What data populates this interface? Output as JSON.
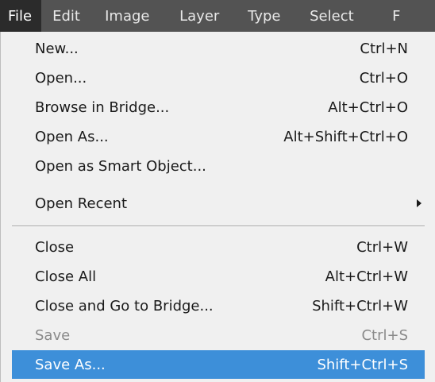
{
  "menubar": {
    "items": [
      {
        "label": "File",
        "active": true
      },
      {
        "label": "Edit"
      },
      {
        "label": "Image"
      },
      {
        "label": "Layer"
      },
      {
        "label": "Type"
      },
      {
        "label": "Select"
      },
      {
        "label": "F"
      }
    ]
  },
  "file_menu": {
    "items": [
      {
        "label": "New...",
        "shortcut": "Ctrl+N"
      },
      {
        "label": "Open...",
        "shortcut": "Ctrl+O"
      },
      {
        "label": "Browse in Bridge...",
        "shortcut": "Alt+Ctrl+O"
      },
      {
        "label": "Open As...",
        "shortcut": "Alt+Shift+Ctrl+O"
      },
      {
        "label": "Open as Smart Object...",
        "shortcut": ""
      },
      {
        "label": "Open Recent",
        "shortcut": "",
        "submenu_icon": "submenu-arrow-icon"
      },
      {
        "label": "Close",
        "shortcut": "Ctrl+W"
      },
      {
        "label": "Close All",
        "shortcut": "Alt+Ctrl+W"
      },
      {
        "label": "Close and Go to Bridge...",
        "shortcut": "Shift+Ctrl+W"
      },
      {
        "label": "Save",
        "shortcut": "Ctrl+S",
        "disabled": true
      },
      {
        "label": "Save As...",
        "shortcut": "Shift+Ctrl+S",
        "highlighted": true
      }
    ]
  },
  "colors": {
    "menubar_bg": "#535353",
    "active_menu_bg": "#2b2b2b",
    "dropdown_bg": "#f0f0f0",
    "highlight_bg": "#3d8fd9",
    "disabled_text": "#8a8a8a"
  }
}
